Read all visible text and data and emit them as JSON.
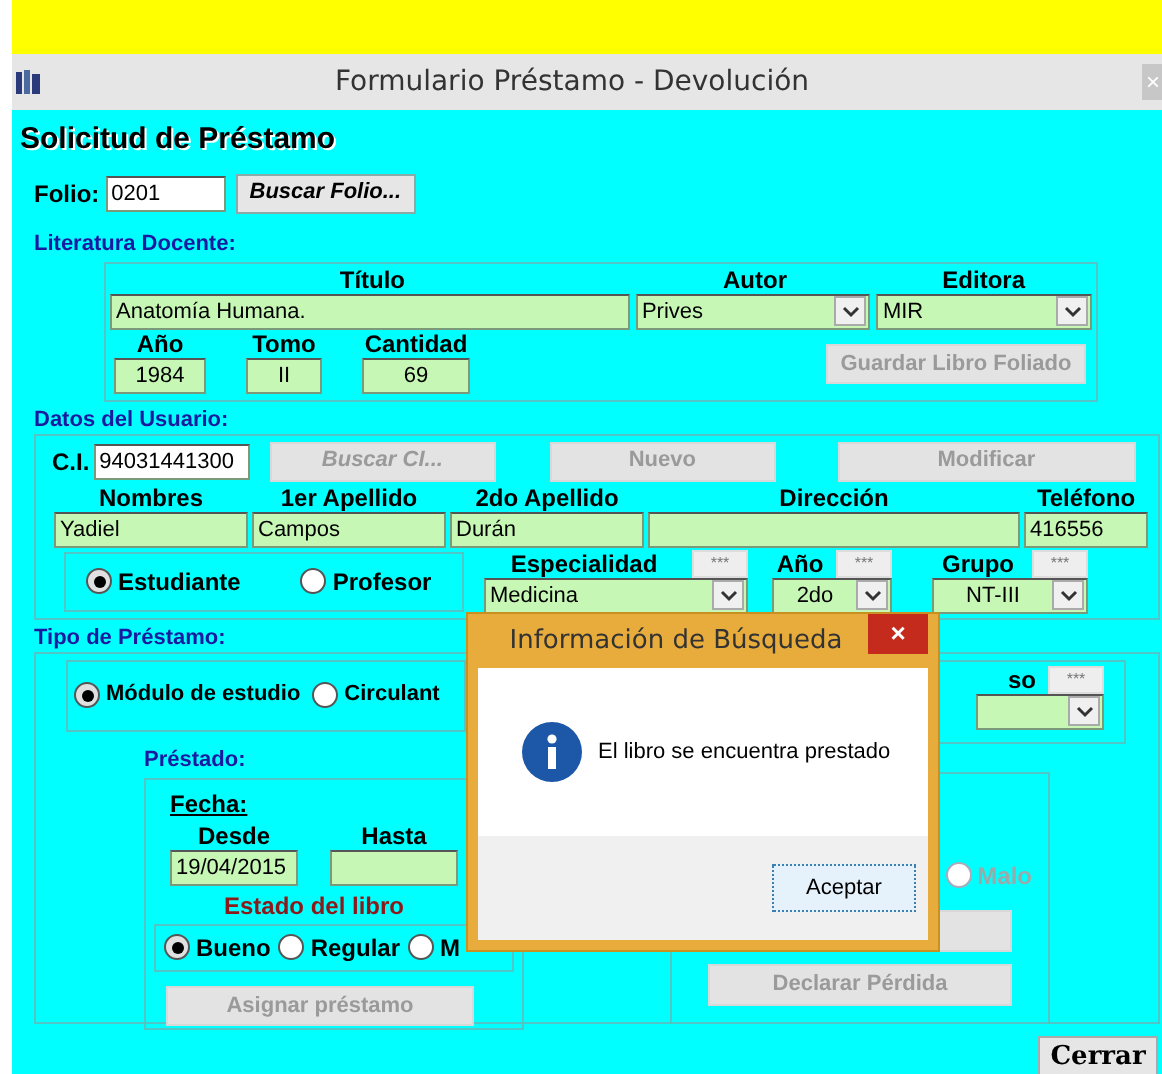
{
  "window": {
    "title": "Formulario Préstamo - Devolución",
    "close": "×"
  },
  "heading": "Solicitud de Préstamo",
  "folio": {
    "label": "Folio:",
    "value": "0201",
    "button": {
      "label": "Buscar Folio...",
      "disabled": false
    }
  },
  "literatura": {
    "title": "Literatura Docente:",
    "titulo": {
      "label": "Título",
      "value": "Anatomía Humana."
    },
    "autor": {
      "label": "Autor",
      "value": "Prives"
    },
    "editora": {
      "label": "Editora",
      "value": "MIR"
    },
    "small_fields": [
      {
        "label": "Año",
        "value": "1984"
      },
      {
        "label": "Tomo",
        "value": "II"
      },
      {
        "label": "Cantidad",
        "value": "69"
      }
    ],
    "button": {
      "label": "Guardar Libro Foliado",
      "disabled": true
    }
  },
  "usuario": {
    "title": "Datos del Usuario:",
    "ci": {
      "label": "C.I.",
      "value": "94031441300"
    },
    "buttons": [
      {
        "label": "Buscar CI...",
        "disabled": true,
        "italic": true
      },
      {
        "label": "Nuevo",
        "disabled": true,
        "italic": false
      },
      {
        "label": "Modificar",
        "disabled": true,
        "italic": false
      }
    ],
    "fields": [
      {
        "label": "Nombres",
        "value": "Yadiel"
      },
      {
        "label": "1er Apellido",
        "value": "Campos"
      },
      {
        "label": "2do Apellido",
        "value": "Durán"
      },
      {
        "label": "Dirección"
      },
      {
        "label": "Teléfono",
        "value": "416556"
      }
    ],
    "roles": [
      {
        "label": "Estudiante",
        "selected": true
      },
      {
        "label": "Profesor",
        "selected": false
      }
    ],
    "selects": [
      {
        "label": "Especialidad",
        "button": "***",
        "value": "Medicina"
      },
      {
        "label": "Año",
        "button": "***",
        "value": "2do"
      },
      {
        "label": "Grupo",
        "button": "***",
        "value": "NT-III"
      }
    ]
  },
  "prestamo": {
    "title": "Tipo de Préstamo:",
    "tipos": [
      {
        "label": "Módulo de estudio",
        "selected": true
      },
      {
        "label": "Circulant",
        "selected": false
      }
    ],
    "uso": {
      "label": "so",
      "button": "***"
    },
    "prestado": {
      "title": "Préstado:",
      "fecha": "Fecha:",
      "desde": {
        "label": "Desde",
        "value": "19/04/2015"
      },
      "hasta": {
        "label": "Hasta"
      },
      "estado_title": "Estado del libro",
      "estados": [
        {
          "label": "Bueno",
          "selected": true
        },
        {
          "label": "Regular",
          "selected": false
        },
        {
          "label": "M",
          "selected": false
        }
      ],
      "button": {
        "label": "Asignar préstamo",
        "disabled": true
      }
    },
    "devolucion": {
      "estados": [
        {
          "label": "Malo",
          "selected": false,
          "disabled": true
        }
      ],
      "buttons": [
        {
          "disabled": true
        },
        {
          "label": "Declarar Pérdida",
          "disabled": true
        }
      ]
    }
  },
  "dialog": {
    "title": "Información de Búsqueda",
    "close": "×",
    "message": "El libro se encuentra prestado",
    "button": "Aceptar"
  },
  "cerrar": {
    "label": "Cerrar"
  }
}
